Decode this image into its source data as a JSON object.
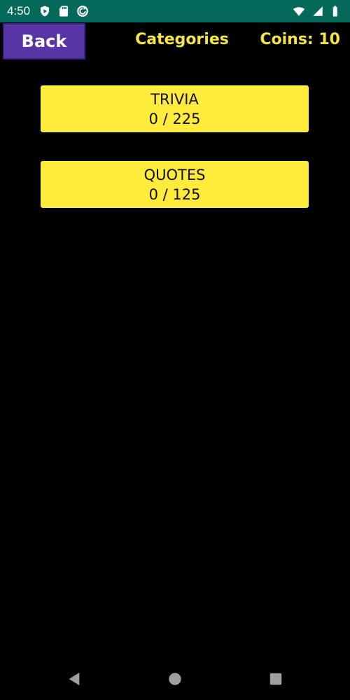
{
  "status_bar": {
    "time": "4:50",
    "left_icons": [
      "shield-icon",
      "sd-card-icon",
      "sync-icon"
    ],
    "right_icons": [
      "wifi-icon",
      "signal-icon",
      "battery-icon"
    ]
  },
  "header": {
    "back_label": "Back",
    "title": "Categories",
    "coins_label": "Coins: 10"
  },
  "categories": [
    {
      "name": "TRIVIA",
      "progress": "0 / 225"
    },
    {
      "name": "QUOTES",
      "progress": "0 / 125"
    }
  ],
  "colors": {
    "status_bar": "#04695a",
    "background": "#000000",
    "back_button": "#5836a8",
    "accent_text": "#f4e542",
    "card": "#ffeb3b"
  },
  "nav_bar": {
    "icons": [
      "nav-back-icon",
      "nav-home-icon",
      "nav-recent-icon"
    ]
  }
}
